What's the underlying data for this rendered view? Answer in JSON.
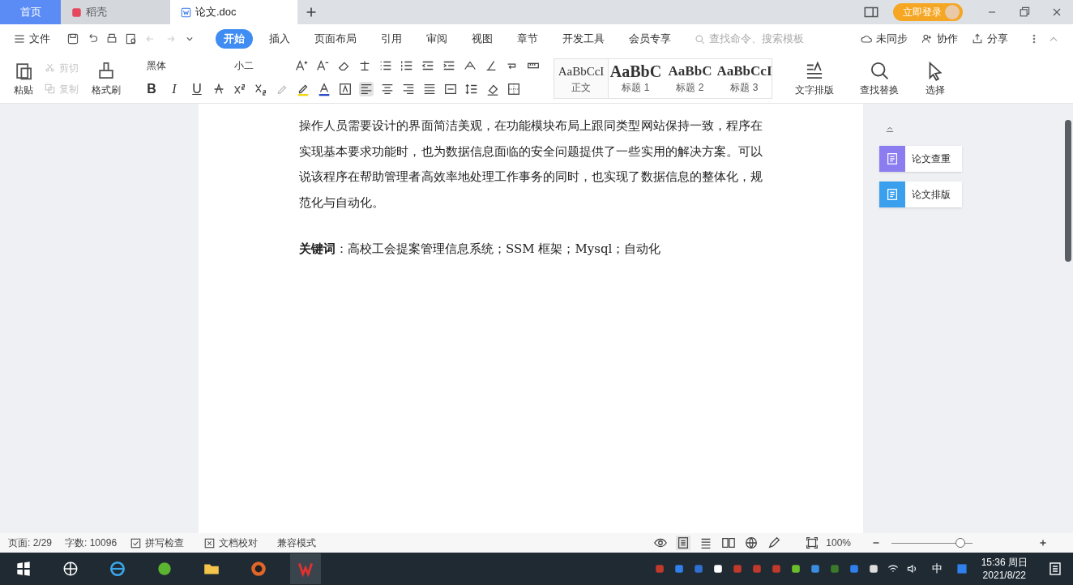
{
  "window_tabs": [
    {
      "label": "首页",
      "kind": "home",
      "selected": false
    },
    {
      "label": "稻壳",
      "kind": "docer",
      "selected": false
    },
    {
      "label": "论文.doc",
      "kind": "doc",
      "selected": true
    }
  ],
  "account": {
    "login": "立即登录"
  },
  "menu": {
    "file": "文件",
    "tabs": [
      {
        "label": "开始",
        "selected": true
      },
      {
        "label": "插入",
        "selected": false
      },
      {
        "label": "页面布局",
        "selected": false
      },
      {
        "label": "引用",
        "selected": false
      },
      {
        "label": "审阅",
        "selected": false
      },
      {
        "label": "视图",
        "selected": false
      },
      {
        "label": "章节",
        "selected": false
      },
      {
        "label": "开发工具",
        "selected": false
      },
      {
        "label": "会员专享",
        "selected": false
      }
    ],
    "search": {
      "placeholder": "查找命令、搜索模板"
    },
    "actions": [
      "未同步",
      "协作",
      "分享"
    ]
  },
  "ribbon": {
    "paste": "粘贴",
    "cut": {
      "label": "剪切",
      "disabled": true
    },
    "copy": {
      "label": "复制",
      "disabled": true
    },
    "format_painter": "格式刷",
    "font": "黑体",
    "size": "小二",
    "format_buttons": [
      "B",
      "I",
      "U"
    ],
    "styles": [
      {
        "sample": "AaBbCcI",
        "label": "正文",
        "kind": "normal"
      },
      {
        "sample": "AaBbC",
        "label": "标题 1",
        "kind": "heavy"
      },
      {
        "sample": "AaBbC",
        "label": "标题 2",
        "kind": "bold"
      },
      {
        "sample": "AaBbCcI",
        "label": "标题 3",
        "kind": "bold"
      }
    ],
    "tools": [
      "文字排版",
      "查找替换",
      "选择"
    ]
  },
  "document": {
    "paragraph": "操作人员需要设计的界面简洁美观，在功能模块布局上跟同类型网站保持一致，程序在实现基本要求功能时，也为数据信息面临的安全问题提供了一些实用的解决方案。可以说该程序在帮助管理者高效率地处理工作事务的同时，也实现了数据信息的整体化，规范化与自动化。",
    "keywords": "**关键词**：高校工会提案管理信息系统；SSM 框架；Mysql；自动化"
  },
  "side_panel": [
    {
      "label": "论文查重",
      "color": "#8b7cf0"
    },
    {
      "label": "论文排版",
      "color": "#3aa0ee"
    }
  ],
  "status_bar": {
    "page": "页面: 2/29",
    "words": "字数: 10096",
    "spell": "拼写检查",
    "proof": "文档校对",
    "mode": "兼容模式",
    "zoom": "100%",
    "zoom_slider": {
      "level": 0.9
    }
  },
  "taskbar": {
    "ime": "中",
    "time": "15:36 周日",
    "date": "2021/8/22"
  }
}
